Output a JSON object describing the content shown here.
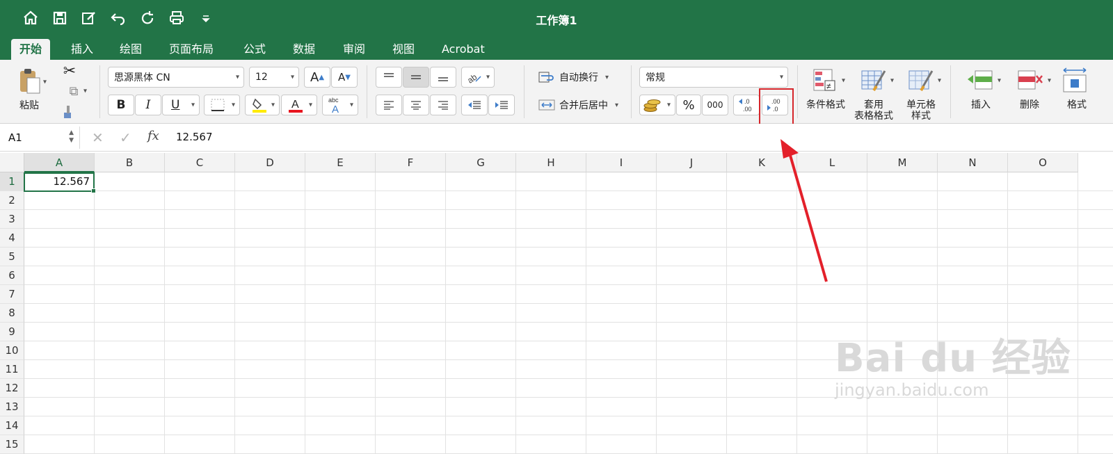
{
  "title": "工作簿1",
  "tabs": [
    "开始",
    "插入",
    "绘图",
    "页面布局",
    "公式",
    "数据",
    "审阅",
    "视图",
    "Acrobat"
  ],
  "ribbon": {
    "paste": "粘贴",
    "font_name": "思源黑体 CN",
    "font_size": "12",
    "bold": "B",
    "italic": "I",
    "underline": "U",
    "wrap_text": "自动换行",
    "merge_center": "合并后居中",
    "number_format": "常规",
    "percent": "%",
    "comma": "000",
    "increase_decimal": ".0\n.00",
    "decrease_decimal": ".00\n.0",
    "conditional_format": "条件格式",
    "format_table_1": "套用",
    "format_table_2": "表格格式",
    "cell_styles_1": "单元格",
    "cell_styles_2": "样式",
    "insert": "插入",
    "delete": "删除",
    "format": "格式"
  },
  "formula_bar": {
    "name_box": "A1",
    "fx": "fx",
    "value": "12.567"
  },
  "columns": [
    "A",
    "B",
    "C",
    "D",
    "E",
    "F",
    "G",
    "H",
    "I",
    "J",
    "K",
    "L",
    "M",
    "N",
    "O"
  ],
  "rows": [
    "1",
    "2",
    "3",
    "4",
    "5",
    "6",
    "7",
    "8",
    "9",
    "10",
    "11",
    "12",
    "13",
    "14",
    "15"
  ],
  "cells": {
    "A1": "12.567"
  },
  "watermark": {
    "line1": "Bai du 经验",
    "line2": "jingyan.baidu.com"
  },
  "colors": {
    "accent": "#227447",
    "annotation": "#d6252a"
  }
}
